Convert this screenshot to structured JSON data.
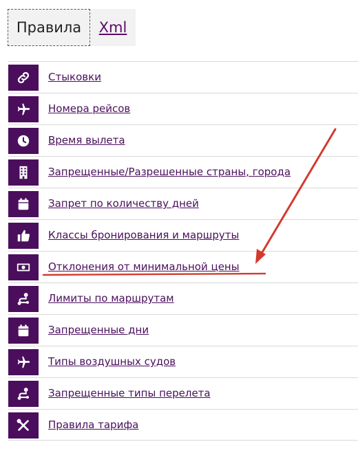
{
  "tabs": {
    "rules_label": "Правила",
    "xml_label": "Xml"
  },
  "colors": {
    "accent": "#4a0e5c",
    "annotation": "#d33a2f"
  },
  "menu": {
    "items": [
      {
        "label": "Стыковки",
        "icon": "link-icon"
      },
      {
        "label": "Номера рейсов",
        "icon": "plane-icon"
      },
      {
        "label": "Время вылета",
        "icon": "clock-icon"
      },
      {
        "label": "Запрещенные/Разрешенные страны, города",
        "icon": "building-icon"
      },
      {
        "label": "Запрет по количеству дней",
        "icon": "calendar-icon"
      },
      {
        "label": "Классы бронирования и маршруты",
        "icon": "thumbs-up-icon"
      },
      {
        "label": "Отклонения от минимальной цены",
        "icon": "money-icon"
      },
      {
        "label": "Лимиты по маршрутам",
        "icon": "route-icon"
      },
      {
        "label": "Запрещенные дни",
        "icon": "calendar-icon"
      },
      {
        "label": "Типы воздушных судов",
        "icon": "plane-icon"
      },
      {
        "label": "Запрещенные типы перелета",
        "icon": "route-icon"
      },
      {
        "label": "Правила тарифа",
        "icon": "tools-icon"
      }
    ]
  }
}
